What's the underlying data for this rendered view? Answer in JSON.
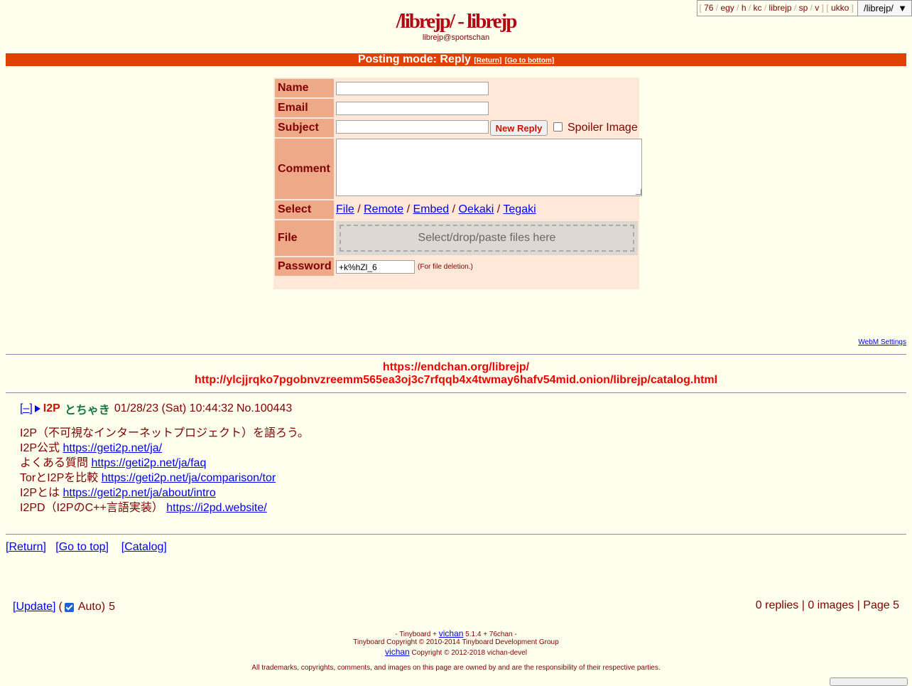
{
  "boardlist": {
    "boards_group1": [
      "76",
      "egy",
      "h",
      "kc",
      "librejp",
      "sp",
      "v"
    ],
    "boards_group2": [
      "ukko"
    ],
    "selected": "/librejp/",
    "dropdown_glyph": "▼"
  },
  "header": {
    "title": "/librejp/ - librejp",
    "subtitle": "librejp@sportschan"
  },
  "postmode": {
    "label": "Posting mode: Reply",
    "return_link": "[Return]",
    "bottom_link": "[Go to bottom]"
  },
  "form": {
    "name_label": "Name",
    "email_label": "Email",
    "subject_label": "Subject",
    "comment_label": "Comment",
    "select_label": "Select",
    "file_label": "File",
    "password_label": "Password",
    "name_value": "",
    "email_value": "",
    "subject_value": "",
    "comment_value": "",
    "submit_label": "New Reply",
    "spoiler_label": "Spoiler Image",
    "spoiler_checked": false,
    "select_options": [
      "File",
      "Remote",
      "Embed",
      "Oekaki",
      "Tegaki"
    ],
    "dropzone_text": "Select/drop/paste files here",
    "password_value": "+k%hZl_6",
    "password_note": "(For file deletion.)"
  },
  "webm_settings": "WebM Settings",
  "announcement": {
    "line1": "https://endchan.org/librejp/",
    "line2": "http://ylcjjrqko7pgobnvzreemm565ea3oj3c7rfqqb4x4twmay6hafv54mid.onion/librejp/catalog.html"
  },
  "thread": {
    "hide_toggle": "[–]",
    "subject": "I2P",
    "name": "とちゃき",
    "date": "01/28/23 (Sat) 10:44:32",
    "number_prefix": "No.",
    "number": "100443",
    "lines": [
      {
        "text": "I2P（不可視なインターネットプロジェクト）を語ろう。",
        "link": ""
      },
      {
        "text": "I2P公式 ",
        "link": "https://geti2p.net/ja/"
      },
      {
        "text": "よくある質問 ",
        "link": "https://geti2p.net/ja/faq"
      },
      {
        "text": "TorとI2Pを比較 ",
        "link": "https://geti2p.net/ja/comparison/tor"
      },
      {
        "text": "I2Pとは ",
        "link": "https://geti2p.net/ja/about/intro"
      },
      {
        "text": "I2PD（I2PのC++言語実装） ",
        "link": "https://i2pd.website/"
      }
    ]
  },
  "nav": {
    "return": "[Return]",
    "top": "[Go to top]",
    "catalog": "[Catalog]"
  },
  "update_bar": {
    "update": "[Update]",
    "open_paren": "(",
    "auto_checked": true,
    "auto_label": "Auto)",
    "countdown": "5",
    "stats": "0 replies | 0 images | Page 5"
  },
  "footer": {
    "line1_pre": "- Tinyboard +",
    "line1_link": "vichan",
    "line1_post": "5.1.4 + 76chan -",
    "line2": "Tinyboard Copyright © 2010-2014 Tinyboard Development Group",
    "line3_link": "vichan",
    "line3_post": "Copyright © 2012-2018 vichan-devel",
    "line4": "All trademarks, copyrights, comments, and images on this page are owned by and are the responsibility of their respective parties."
  }
}
